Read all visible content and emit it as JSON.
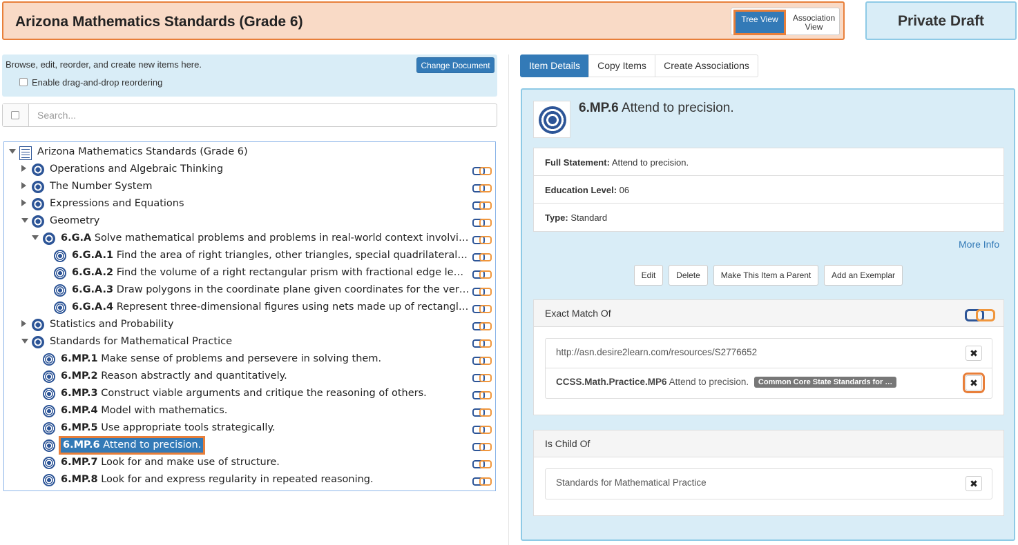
{
  "header": {
    "title": "Arizona Mathematics Standards (Grade 6)",
    "tree_view_label": "Tree View",
    "association_view_label": "Association View",
    "status": "Private Draft"
  },
  "left": {
    "info_text": "Browse, edit, reorder, and create new items here.",
    "change_document_label": "Change Document",
    "drag_drop_label": "Enable drag-and-drop reordering",
    "search_placeholder": "Search...",
    "tree": [
      {
        "code": "",
        "text": "Arizona Mathematics Standards (Grade 6)",
        "level": 0,
        "toggle": "down",
        "icon": "document-icon",
        "link": false
      },
      {
        "code": "",
        "text": "Operations and Algebraic Thinking",
        "level": 1,
        "toggle": "right",
        "icon": "standard-icon",
        "link": true
      },
      {
        "code": "",
        "text": "The Number System",
        "level": 1,
        "toggle": "right",
        "icon": "standard-icon",
        "link": true
      },
      {
        "code": "",
        "text": "Expressions and Equations",
        "level": 1,
        "toggle": "right",
        "icon": "standard-icon",
        "link": true
      },
      {
        "code": "",
        "text": "Geometry",
        "level": 1,
        "toggle": "down",
        "icon": "standard-icon",
        "link": true
      },
      {
        "code": "6.G.A",
        "text": "Solve mathematical problems and problems in real-world context involving area, …",
        "level": 2,
        "toggle": "down",
        "icon": "standard-icon",
        "link": true
      },
      {
        "code": "6.G.A.1",
        "text": "Find the area of right triangles, other triangles, special quadrilaterals, and po…",
        "level": 3,
        "toggle": "",
        "icon": "target-icon",
        "link": true
      },
      {
        "code": "6.G.A.2",
        "text": "Find the volume of a right rectangular prism with fractional edge lengths by …",
        "level": 3,
        "toggle": "",
        "icon": "target-icon",
        "link": true
      },
      {
        "code": "6.G.A.3",
        "text": "Draw polygons in the coordinate plane given coordinates for the vertices; us…",
        "level": 3,
        "toggle": "",
        "icon": "target-icon",
        "link": true
      },
      {
        "code": "6.G.A.4",
        "text": "Represent three-dimensional figures using nets made up of rectangles and tr…",
        "level": 3,
        "toggle": "",
        "icon": "target-icon",
        "link": true
      },
      {
        "code": "",
        "text": "Statistics and Probability",
        "level": 1,
        "toggle": "right",
        "icon": "standard-icon",
        "link": true
      },
      {
        "code": "",
        "text": "Standards for Mathematical Practice",
        "level": 1,
        "toggle": "down",
        "icon": "standard-icon",
        "link": true
      },
      {
        "code": "6.MP.1",
        "text": "Make sense of problems and persevere in solving them.",
        "level": 2,
        "toggle": "",
        "icon": "target-icon",
        "link": true
      },
      {
        "code": "6.MP.2",
        "text": "Reason abstractly and quantitatively.",
        "level": 2,
        "toggle": "",
        "icon": "target-icon",
        "link": true
      },
      {
        "code": "6.MP.3",
        "text": "Construct viable arguments and critique the reasoning of others.",
        "level": 2,
        "toggle": "",
        "icon": "target-icon",
        "link": true
      },
      {
        "code": "6.MP.4",
        "text": "Model with mathematics.",
        "level": 2,
        "toggle": "",
        "icon": "target-icon",
        "link": true
      },
      {
        "code": "6.MP.5",
        "text": "Use appropriate tools strategically.",
        "level": 2,
        "toggle": "",
        "icon": "target-icon",
        "link": true
      },
      {
        "code": "6.MP.6",
        "text": "Attend to precision.",
        "level": 2,
        "toggle": "",
        "icon": "target-icon",
        "link": true,
        "selected": true
      },
      {
        "code": "6.MP.7",
        "text": "Look for and make use of structure.",
        "level": 2,
        "toggle": "",
        "icon": "target-icon",
        "link": true
      },
      {
        "code": "6.MP.8",
        "text": "Look for and express regularity in repeated reasoning.",
        "level": 2,
        "toggle": "",
        "icon": "target-icon",
        "link": true
      }
    ]
  },
  "right": {
    "tabs": [
      "Item Details",
      "Copy Items",
      "Create Associations"
    ],
    "item": {
      "code": "6.MP.6",
      "title": "Attend to precision.",
      "full_statement_label": "Full Statement:",
      "full_statement": "Attend to precision.",
      "education_level_label": "Education Level:",
      "education_level": "06",
      "type_label": "Type:",
      "type": "Standard"
    },
    "more_info_label": "More Info",
    "actions": [
      "Edit",
      "Delete",
      "Make This Item a Parent",
      "Add an Exemplar"
    ],
    "exact_match": {
      "heading": "Exact Match Of",
      "items": [
        {
          "code": "",
          "text": "http://asn.desire2learn.com/resources/S2776652",
          "tag": ""
        },
        {
          "code": "CCSS.Math.Practice.MP6",
          "text": "Attend to precision.",
          "tag": "Common Core State Standards for …"
        }
      ]
    },
    "is_child_of": {
      "heading": "Is Child Of",
      "items": [
        {
          "text": "Standards for Mathematical Practice"
        }
      ]
    },
    "remove_glyph": "✖"
  },
  "colors": {
    "accent_orange": "#e87f3a",
    "primary_blue": "#337ab7",
    "icon_navy": "#2d5597",
    "info_bg": "#d9edf7"
  }
}
